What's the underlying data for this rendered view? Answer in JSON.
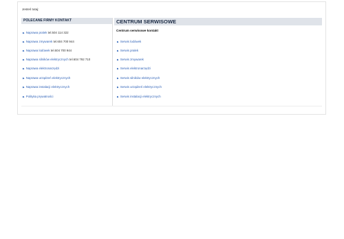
{
  "breadcrumb": {
    "label": "Jesteś tutaj:"
  },
  "left_panel": {
    "header": "POLECANE FIRMY KONTAKT",
    "items": [
      {
        "link": "Naprawa pralek",
        "extra": " tel.504 114 322"
      },
      {
        "link": "Naprawa zmywarek",
        "extra": " tel.604 700 944"
      },
      {
        "link": "Naprawa lodówek",
        "extra": " tel.604 700 944"
      },
      {
        "link": "Naprawa silników elektrycznych",
        "extra": " tel.604 792 710"
      },
      {
        "link": "Naprawa elektronarzędzi",
        "extra": ""
      },
      {
        "link": "Naprawa urządzeń elektrycznych",
        "extra": ""
      },
      {
        "link": "Naprawa instalacji elektrycznych",
        "extra": ""
      },
      {
        "link": "Polityka prywatności",
        "extra": ""
      }
    ]
  },
  "right_panel": {
    "header": "CENTRUM SERWISOWE",
    "subheader": "Centrum serwisowe kontakt",
    "items": [
      "Serwis lodówek",
      "Serwis pralek",
      "Serwis zmywarek",
      "Serwis elektronarzędzi",
      "Serwis silników elektrycznych",
      "Serwis urządzeń elektrycznych",
      "Serwis instalacji elektrycznych"
    ]
  },
  "colors": {
    "accent": "#2b5fb6",
    "header_bg": "#dfe3e9"
  },
  "icons": {
    "bullet": "arrow-right-icon"
  }
}
